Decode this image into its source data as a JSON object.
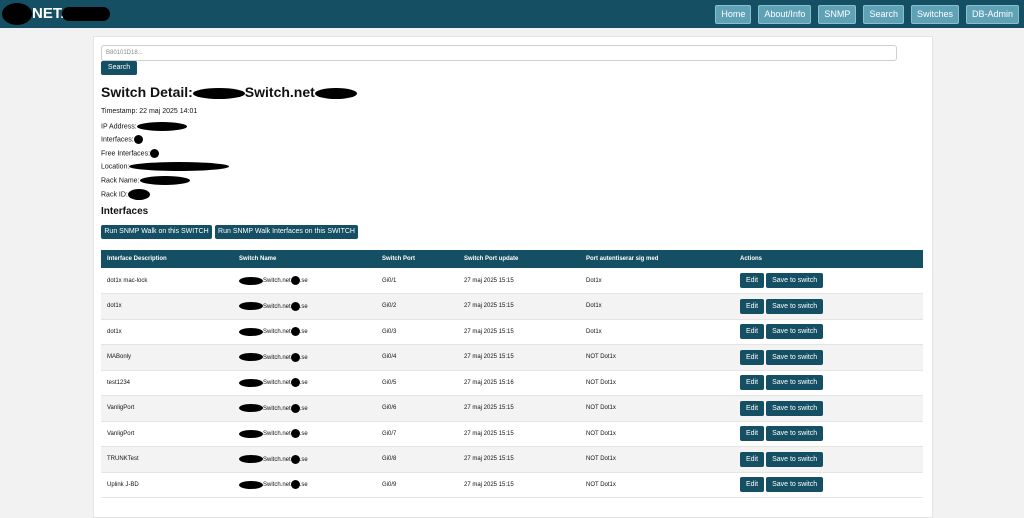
{
  "header": {
    "brand": "NET.",
    "nav": [
      "Home",
      "About/Info",
      "SNMP",
      "Search",
      "Switches",
      "DB-Admin"
    ]
  },
  "search": {
    "placeholder": "B80101D18...",
    "button_label": "Search"
  },
  "detail": {
    "title_prefix": "Switch Detail:",
    "title_suffix": "Switch.net",
    "timestamp": "Timestamp: 22 maj 2025 14:01",
    "ip_label": "IP Address:",
    "interfaces_label": "Interfaces:",
    "free_interfaces_label": "Free Interfaces:",
    "location_label": "Location:",
    "rack_name_label": "Rack Name:",
    "rack_id_label": "Rack ID:"
  },
  "interfaces": {
    "heading": "Interfaces",
    "snmp_walk_label": "Run SNMP Walk on this SWITCH",
    "snmp_walk_interfaces_label": "Run SNMP Walk Interfaces on this SWITCH",
    "columns": [
      "Interface Description",
      "Switch Name",
      "Switch Port",
      "Switch Port update",
      "Port autentiserar sig med",
      "Actions"
    ],
    "edit_label": "Edit",
    "save_label": "Save to switch",
    "rows": [
      {
        "desc": "dot1x mac-lock",
        "name_mid": "Switch.net",
        "name_end": ".se",
        "port": "Gi0/1",
        "update": "27 maj 2025 15:15",
        "auth": "Dot1x"
      },
      {
        "desc": "dot1x",
        "name_mid": "Switch.net",
        "name_end": ".se",
        "port": "Gi0/2",
        "update": "27 maj 2025 15:15",
        "auth": "Dot1x"
      },
      {
        "desc": "dot1x",
        "name_mid": "Switch.net",
        "name_end": ".se",
        "port": "Gi0/3",
        "update": "27 maj 2025 15:15",
        "auth": "Dot1x"
      },
      {
        "desc": "MABonly",
        "name_mid": "Switch.net",
        "name_end": ".se",
        "port": "Gi0/4",
        "update": "27 maj 2025 15:15",
        "auth": "NOT Dot1x"
      },
      {
        "desc": "test1234",
        "name_mid": "Switch.net",
        "name_end": ".se",
        "port": "Gi0/5",
        "update": "27 maj 2025 15:16",
        "auth": "NOT Dot1x"
      },
      {
        "desc": "VanligPort",
        "name_mid": "Switch.net",
        "name_end": ".se",
        "port": "Gi0/6",
        "update": "27 maj 2025 15:15",
        "auth": "NOT Dot1x"
      },
      {
        "desc": "VanligPort",
        "name_mid": "Switch.net",
        "name_end": ".se",
        "port": "Gi0/7",
        "update": "27 maj 2025 15:15",
        "auth": "NOT Dot1x"
      },
      {
        "desc": "TRUNKTest",
        "name_mid": "Switch.net",
        "name_end": ".se",
        "port": "Gi0/8",
        "update": "27 maj 2025 15:15",
        "auth": "NOT Dot1x"
      },
      {
        "desc": "Uplink J-BD",
        "name_mid": "Switch.net",
        "name_end": ".se",
        "port": "Gi0/9",
        "update": "27 maj 2025 15:15",
        "auth": "NOT Dot1x"
      }
    ]
  },
  "colors": {
    "primary": "#144f63",
    "nav_button": "#5fa2b6",
    "background": "#f2f2f2"
  }
}
